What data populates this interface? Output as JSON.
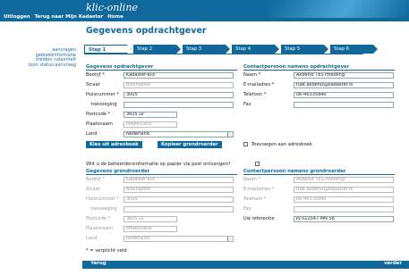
{
  "header": {
    "brand": "klic-online",
    "nav": [
      "Uitloggen",
      "Terug naar Mijn Kadaster",
      "Home"
    ]
  },
  "sidebar": [
    "aanvragen",
    "gebiedsinformatie",
    "melden calamiteit",
    "toon status aanvraag"
  ],
  "page_title": "Gegevens opdrachtgever",
  "steps": [
    "Stap 1",
    "Stap 2",
    "Stap 3",
    "Stap 4",
    "Stap 5",
    "Stap 6"
  ],
  "opdrachtgever": {
    "title": "Gegevens opdrachtgever",
    "labels": {
      "bedrijf": "Bedrijf *",
      "straat": "Straat",
      "huisnummer": "Huisnummer *",
      "toevoeging": "toevoeging",
      "postcode": "Postcode *",
      "plaatsnaam": "Plaatsnaam",
      "land": "Land"
    },
    "values": {
      "bedrijf": "Kadaster-Klic",
      "straat": "Bisonspoor",
      "huisnummer": "3005",
      "toevoeging": "",
      "postcode": "3605 LV",
      "plaatsnaam": "MAARSSEN",
      "land": "Nederland"
    }
  },
  "contact_opdrachtgever": {
    "title": "Contactpersoon namens opdrachtgever",
    "labels": {
      "naam": "Naam *",
      "email": "E-mailadres *",
      "telefoon": "Telefoon *",
      "fax": "Fax"
    },
    "values": {
      "naam": "Akdeniz TESTmelding",
      "email": "fuat.akdeniz@kadaster.nl",
      "telefoon": "06-46335840",
      "fax": ""
    }
  },
  "buttons": {
    "adresboek": "Kies uit adresboek",
    "kopieer": "Kopieer grondroerder",
    "terug": "terug",
    "verder": "verder"
  },
  "toevoegen_label": "Toevoegen aan adresboek",
  "papier_question": "Wilt u de beheerdersinformatie op papier via post ontvangen?",
  "grondroerder": {
    "title": "Gegevens grondroerder",
    "labels": {
      "bedrijf": "Bedrijf *",
      "straat": "Straat",
      "huisnummer": "Huisnummer *",
      "toevoeging": "toevoeging",
      "postcode": "Postcode *",
      "plaatsnaam": "Plaatsnaam",
      "land": "Land"
    },
    "values": {
      "bedrijf": "Kadaster-Klic",
      "straat": "Bisonspoor",
      "huisnummer": "3005",
      "toevoeging": "",
      "postcode": "3605 LV",
      "plaatsnaam": "MAARSSEN",
      "land": "Nederland"
    }
  },
  "contact_grondroerder": {
    "title": "Contactpersoon namens grondroerder",
    "labels": {
      "naam": "Naam *",
      "email": "E-mailadres *",
      "telefoon": "Telefoon *",
      "fax": "Fax",
      "referentie": "Uw referentie"
    },
    "values": {
      "naam": "Akdeniz TESTmelding",
      "email": "fuat.akdeniz@kadaster.nl",
      "telefoon": "06-46335840",
      "fax": "",
      "referentie": "PJ 012547 MN 58"
    }
  },
  "verplicht": "* = verplicht veld"
}
